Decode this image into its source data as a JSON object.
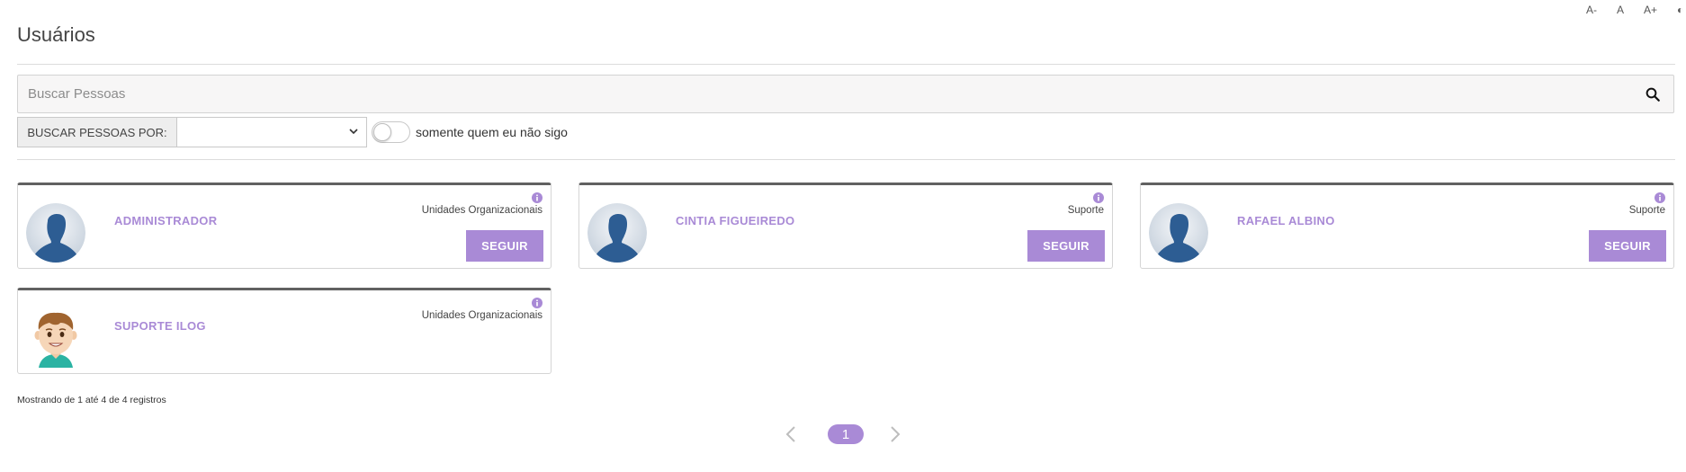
{
  "font_controls": {
    "decrease": "A-",
    "normal": "A",
    "increase": "A+",
    "contrast": "◐"
  },
  "page": {
    "title": "Usuários"
  },
  "search": {
    "placeholder": "Buscar Pessoas",
    "value": ""
  },
  "filter": {
    "label": "BUSCAR PESSOAS POR:",
    "select_value": "",
    "toggle_label": "somente quem eu não sigo",
    "toggle_on": false
  },
  "colors": {
    "accent": "#a98ad6",
    "card_top_border": "#616161",
    "avatar_blue": "#2d5d93"
  },
  "users": [
    {
      "name": "ADMINISTRADOR",
      "category": "Unidades Organizacionais",
      "follow_label": "SEGUIR",
      "avatar": "silhouette",
      "show_follow": true
    },
    {
      "name": "CINTIA FIGUEIREDO",
      "category": "Suporte",
      "follow_label": "SEGUIR",
      "avatar": "silhouette",
      "show_follow": true
    },
    {
      "name": "RAFAEL ALBINO",
      "category": "Suporte",
      "follow_label": "SEGUIR",
      "avatar": "silhouette",
      "show_follow": true
    },
    {
      "name": "SUPORTE ILOG",
      "category": "Unidades Organizacionais",
      "follow_label": "SEGUIR",
      "avatar": "cartoon-boy",
      "show_follow": false
    }
  ],
  "records_text": "Mostrando de 1 até 4 de 4 registros",
  "pagination": {
    "current_page": "1"
  }
}
